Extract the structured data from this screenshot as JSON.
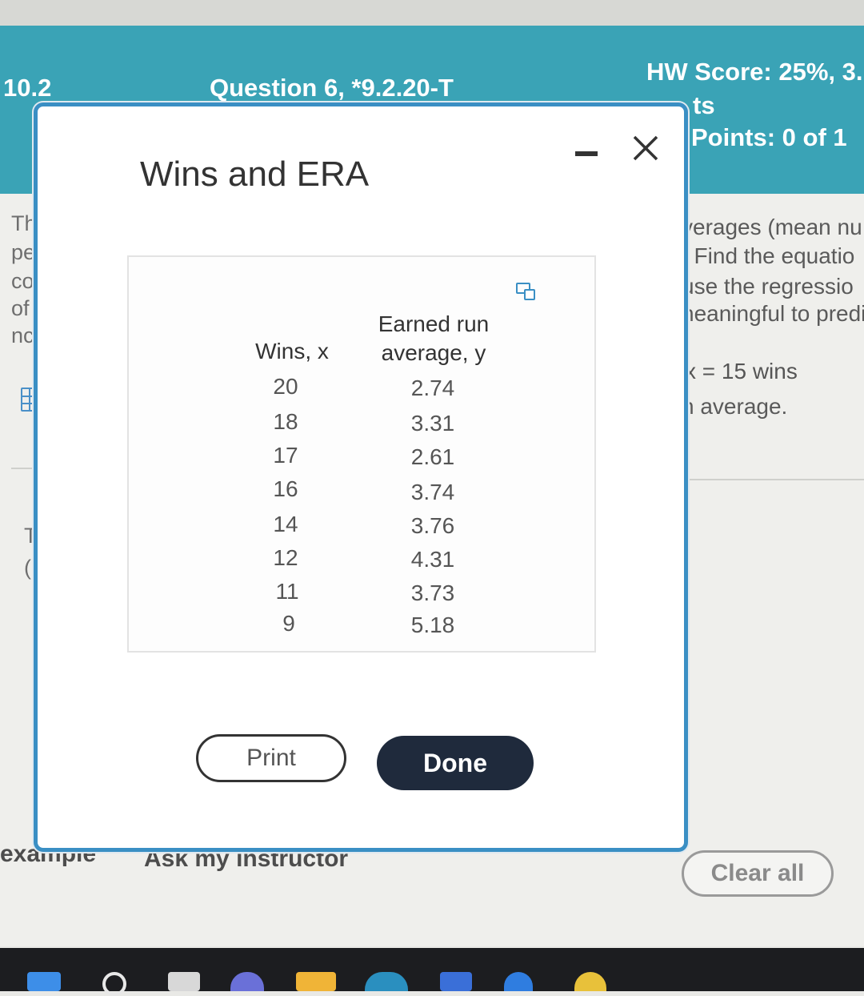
{
  "header": {
    "section": "10.2",
    "question": "Question 6, *9.2.20-T",
    "hw_score": "HW Score: 25%, 3.",
    "points_partial": "ts",
    "points": "Points: 0 of 1"
  },
  "background_text": {
    "left_fragments": [
      "Th",
      "pe",
      "co",
      "of",
      "nc",
      "Th",
      "(R"
    ],
    "right_fragments": [
      "verages (mean nu",
      ". Find the equatio",
      "use the regressio",
      "neaningful to predi",
      "x = 15 wins",
      "n average."
    ]
  },
  "modal": {
    "title": "Wins and ERA",
    "table": {
      "headers": {
        "x": "Wins, x",
        "y_line1": "Earned run",
        "y_line2": "average, y"
      },
      "rows": [
        {
          "x": "20",
          "y": "2.74"
        },
        {
          "x": "18",
          "y": "3.31"
        },
        {
          "x": "17",
          "y": "2.61"
        },
        {
          "x": "16",
          "y": "3.74"
        },
        {
          "x": "14",
          "y": "3.76"
        },
        {
          "x": "12",
          "y": "4.31"
        },
        {
          "x": "11",
          "y": "3.73"
        },
        {
          "x": "9",
          "y": "5.18"
        }
      ]
    },
    "print_label": "Print",
    "done_label": "Done"
  },
  "footer": {
    "example_label": "example",
    "instructor_label": "Ask my instructor",
    "clear_all_label": "Clear all"
  },
  "colors": {
    "header_bg": "#3aa3b6",
    "modal_border": "#3a8fc4",
    "done_button": "#1f2a3c"
  }
}
